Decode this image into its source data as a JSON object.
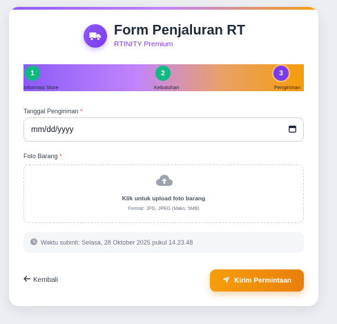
{
  "header": {
    "title": "Form Penjaluran RT",
    "subtitle": "RTINITY Premium",
    "logo_icon": "truck-icon"
  },
  "stepper": {
    "steps": [
      {
        "number": "1",
        "label": "Informasi Store",
        "status": "completed"
      },
      {
        "number": "2",
        "label": "Kebutuhan",
        "status": "completed"
      },
      {
        "number": "3",
        "label": "Pengiriman",
        "status": "active"
      }
    ]
  },
  "form": {
    "date_label": "Tanggal Pengiriman",
    "date_placeholder": "mm/dd/yyyy",
    "date_icon": "calendar-icon",
    "photo_label": "Foto Barang",
    "required_mark": "*",
    "upload_icon": "cloud-upload-icon",
    "upload_text": "Klik untuk upload foto barang",
    "upload_hint": "Format: JPG, JPEG (Maks. 5MB)"
  },
  "timestamp": {
    "icon": "clock-icon",
    "text": "Waktu submit: Selasa, 28 Oktober 2025 pukul 14.23.48"
  },
  "actions": {
    "back_label": "Kembali",
    "back_icon": "arrow-left-icon",
    "submit_label": "Kirim Permintaan",
    "submit_icon": "paper-plane-icon"
  },
  "colors": {
    "primary": "#7c3aed",
    "accent": "#f59e0b",
    "success": "#10b981",
    "required": "#ef4444"
  }
}
